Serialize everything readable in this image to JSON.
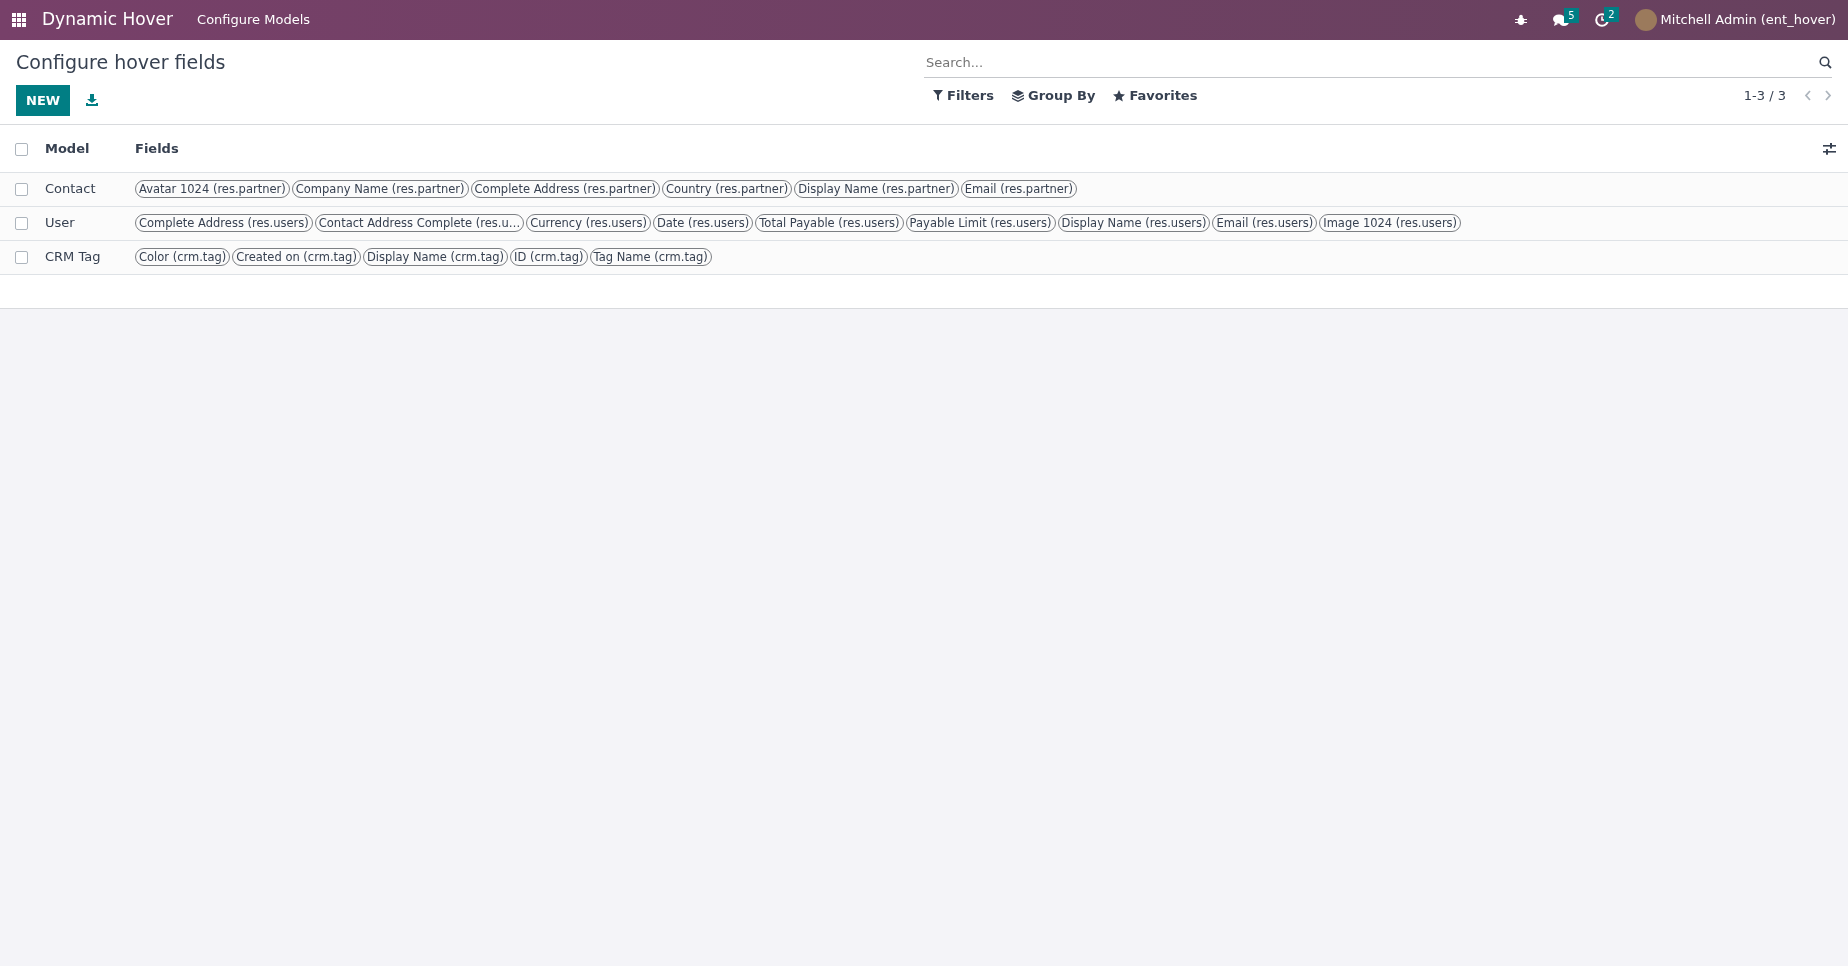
{
  "navbar": {
    "app_name": "Dynamic Hover",
    "menu": [
      "Configure Models"
    ],
    "messages_count": "5",
    "activities_count": "2",
    "user": "Mitchell Admin (ent_hover)"
  },
  "control_panel": {
    "title": "Configure hover fields",
    "new_button": "NEW",
    "search": {
      "placeholder": "Search..."
    },
    "filters": [
      "Filters",
      "Group By",
      "Favorites"
    ],
    "pager": "1-3 / 3"
  },
  "table": {
    "columns": [
      "Model",
      "Fields"
    ],
    "header_checked": false,
    "rows": [
      {
        "model": "Contact",
        "checked": false,
        "fields": [
          "Avatar 1024 (res.partner)",
          "Company Name (res.partner)",
          "Complete Address (res.partner)",
          "Country (res.partner)",
          "Display Name (res.partner)",
          "Email (res.partner)"
        ]
      },
      {
        "model": "User",
        "checked": false,
        "fields": [
          "Complete Address (res.users)",
          "Contact Address Complete (res.u…",
          "Currency (res.users)",
          "Date (res.users)",
          "Total Payable (res.users)",
          "Payable Limit (res.users)",
          "Display Name (res.users)",
          "Email (res.users)",
          "Image 1024 (res.users)"
        ]
      },
      {
        "model": "CRM Tag",
        "checked": false,
        "fields": [
          "Color (crm.tag)",
          "Created on (crm.tag)",
          "Display Name (crm.tag)",
          "ID (crm.tag)",
          "Tag Name (crm.tag)"
        ]
      }
    ]
  }
}
